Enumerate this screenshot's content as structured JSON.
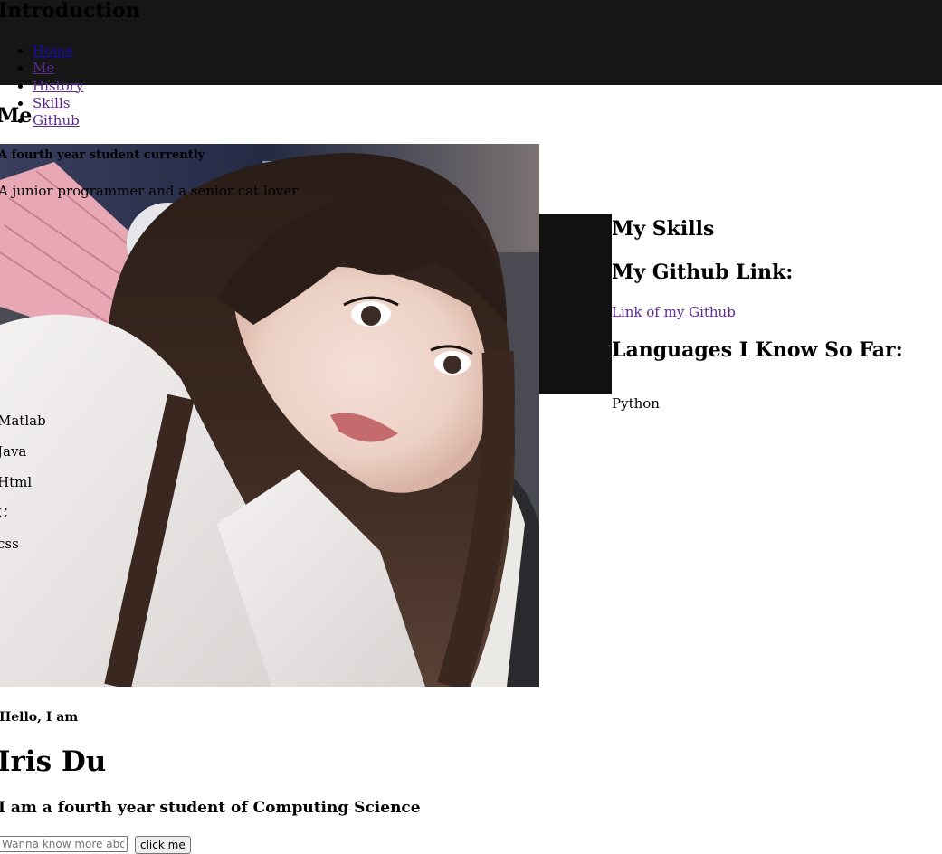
{
  "header": {
    "title": "Introduction",
    "nav": [
      {
        "label": "Home"
      },
      {
        "label": "Me"
      },
      {
        "label": "History"
      },
      {
        "label": "Skills"
      },
      {
        "label": "Github"
      }
    ],
    "background_color": "#171617"
  },
  "me_section": {
    "heading": "Me",
    "status": "A fourth year student currently",
    "tagline": "A junior programmer and a senior cat lover",
    "languages": [
      "Matlab",
      "Java",
      "Html",
      "C",
      "css"
    ]
  },
  "skills_section": {
    "title": "My Skills",
    "github_heading": "My Github Link:",
    "github_link_label": "Link of my Github",
    "languages_heading": "Languages I Know So Far:",
    "first_language": "Python"
  },
  "intro": {
    "greeting": "Hello, I am",
    "name": "Iris Du",
    "description": "I am a fourth year student of Computing Science"
  },
  "form": {
    "input_placeholder": "Wanna know more about me?",
    "button_label": "click me"
  },
  "colors": {
    "visited_link": "#5a2a8f",
    "link": "#1a0dab",
    "box": "#111111"
  }
}
